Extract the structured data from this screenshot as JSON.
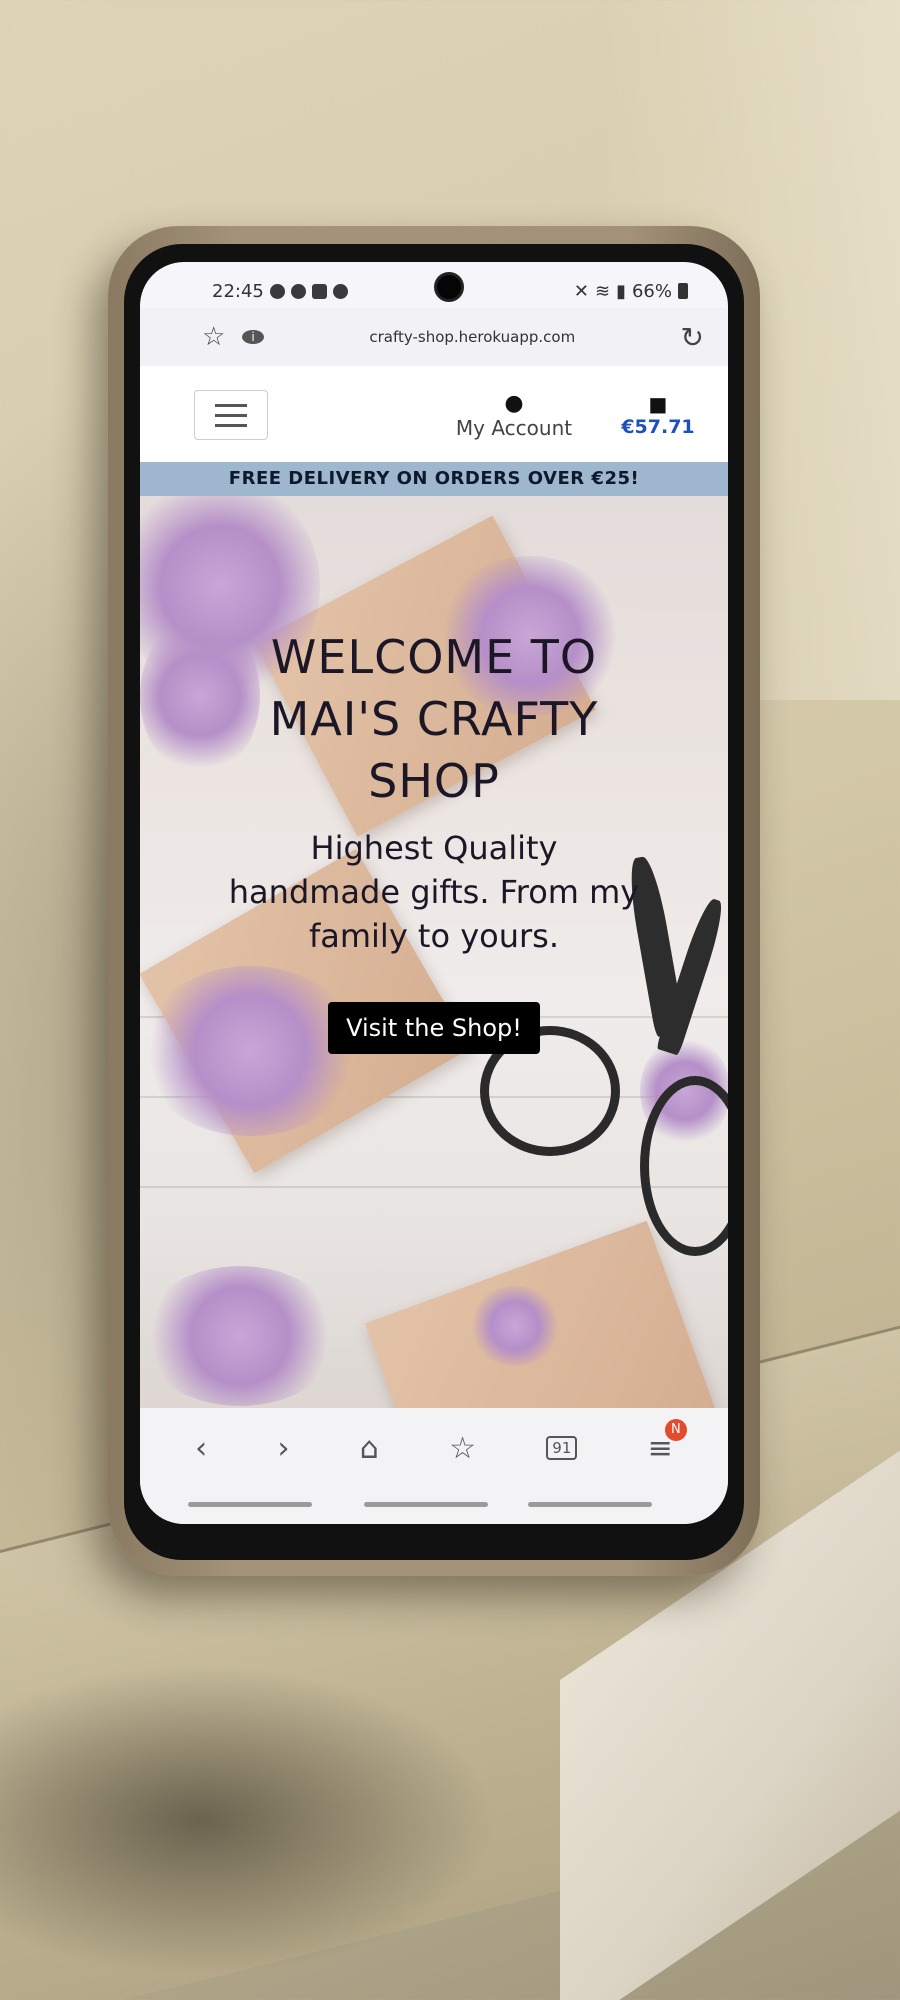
{
  "status_bar": {
    "time": "22:45",
    "battery": "66%"
  },
  "browser": {
    "url": "crafty-shop.herokuapp.com",
    "icons": [
      "star-icon",
      "info-icon",
      "reload-icon"
    ]
  },
  "nav": {
    "account_label": "My Account",
    "bag_total": "€57.71"
  },
  "banner": {
    "text": "FREE DELIVERY ON ORDERS OVER €25!"
  },
  "hero": {
    "title": "WELCOME TO MAI'S CRAFTY SHOP",
    "subtitle": "Highest Quality handmade gifts. From my family to yours.",
    "button_label": "Visit the Shop!"
  },
  "bottom_toolbar": {
    "tab_count": "91",
    "notification_badge": "N",
    "icons": [
      "back-icon",
      "forward-icon",
      "home-icon",
      "bookmarks-icon",
      "tabs-icon",
      "menu-icon"
    ]
  },
  "colors": {
    "banner_bg": "#9fb6cf",
    "price_blue": "#1e4fbf",
    "button_bg": "#000000",
    "badge_red": "#e24b2c"
  }
}
